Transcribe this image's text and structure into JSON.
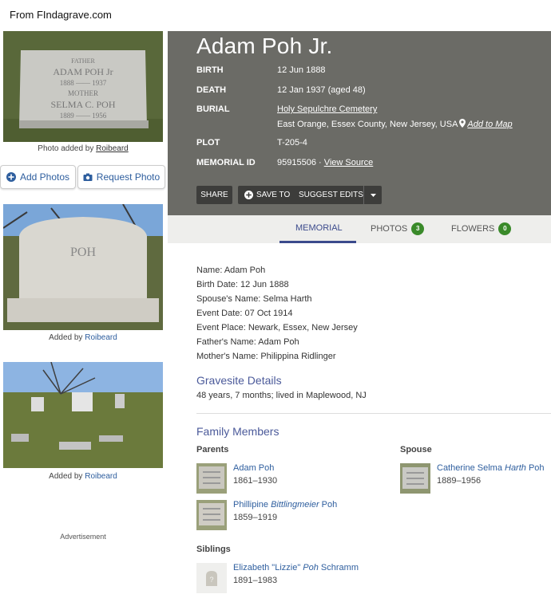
{
  "source_caption": "From FIndagrave.com",
  "memorial": {
    "name": "Adam Poh Jr.",
    "facts": [
      {
        "label": "BIRTH",
        "value": "12 Jun 1888"
      },
      {
        "label": "DEATH",
        "value": "12 Jan 1937 (aged 48)"
      },
      {
        "label": "BURIAL",
        "value": "Holy Sepulchre Cemetery",
        "value2": "East Orange, Essex County, New Jersey, USA",
        "map_link": "Add to Map"
      },
      {
        "label": "PLOT",
        "value": "T-205-4"
      },
      {
        "label": "MEMORIAL ID",
        "value": "95915506 · ",
        "link": "View Source"
      }
    ],
    "buttons": {
      "share": "SHARE",
      "save_to": "SAVE TO",
      "suggest_edits": "SUGGEST EDITS"
    }
  },
  "headstone_text": {
    "line1": "FATHER",
    "line2": "ADAM POH Jr",
    "line3": "1888 —— 1937",
    "line4": "MOTHER",
    "line5": "SELMA C. POH",
    "line6": "1889 —— 1956",
    "thumb1": "POH"
  },
  "left": {
    "photo_added_prefix": "Photo added by ",
    "photo_added_by": "Roibeard",
    "add_photos": "Add Photos",
    "request_photo": "Request Photo",
    "added_by_prefix": "Added by ",
    "added_by": "Roibeard",
    "advertisement": "Advertisement"
  },
  "tabs": [
    {
      "label": "MEMORIAL"
    },
    {
      "label": "PHOTOS",
      "count": "3"
    },
    {
      "label": "FLOWERS",
      "count": "0"
    }
  ],
  "bio": [
    "Name: Adam Poh",
    "Birth Date: 12 Jun 1888",
    "Spouse's Name: Selma Harth",
    "Event Date: 07 Oct 1914",
    "Event Place: Newark, Essex, New Jersey",
    "Father's Name: Adam Poh",
    "Mother's Name: Philippina Ridlinger"
  ],
  "gravesite": {
    "title": "Gravesite Details",
    "text": "48 years, 7 months; lived in Maplewood, NJ"
  },
  "family": {
    "title": "Family Members",
    "parents_label": "Parents",
    "spouse_label": "Spouse",
    "siblings_label": "Siblings",
    "parents": [
      {
        "first": "Adam Poh",
        "italic": "",
        "last": "",
        "dates": "1861–1930"
      },
      {
        "first": "Phillipine ",
        "italic": "Bittlingmeier",
        "last": " Poh",
        "dates": "1859–1919"
      }
    ],
    "spouse": {
      "first": "Catherine Selma ",
      "italic": "Harth",
      "last": " Poh",
      "dates": "1889–1956"
    },
    "siblings": [
      {
        "first": "Elizabeth \"Lizzie\" ",
        "italic": "Poh",
        "last": " Schramm",
        "dates": "1891–1983"
      }
    ]
  },
  "colors": {
    "header_bg": "#6b6b66",
    "accent": "#3b4a8c",
    "link": "#2e5e9e",
    "badge": "#3a8a2a"
  }
}
